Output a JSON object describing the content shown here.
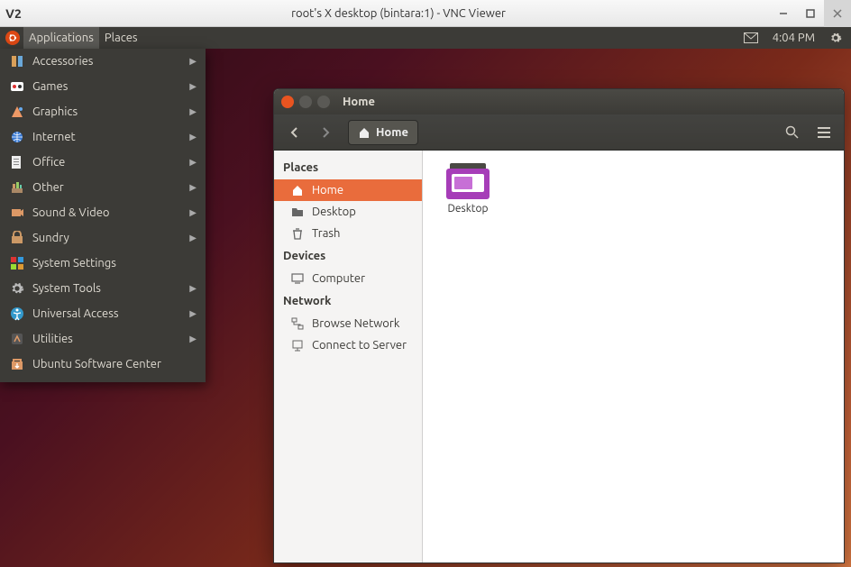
{
  "vnc": {
    "logo": "V2",
    "title": "root's X desktop (bintara:1) - VNC Viewer"
  },
  "panel": {
    "applications": "Applications",
    "places": "Places",
    "clock": "4:04 PM"
  },
  "app_menu": {
    "items": [
      {
        "label": "Accessories",
        "submenu": true
      },
      {
        "label": "Games",
        "submenu": true
      },
      {
        "label": "Graphics",
        "submenu": true
      },
      {
        "label": "Internet",
        "submenu": true
      },
      {
        "label": "Office",
        "submenu": true
      },
      {
        "label": "Other",
        "submenu": true
      },
      {
        "label": "Sound & Video",
        "submenu": true
      },
      {
        "label": "Sundry",
        "submenu": true
      },
      {
        "label": "System Settings",
        "submenu": false
      },
      {
        "label": "System Tools",
        "submenu": true
      },
      {
        "label": "Universal Access",
        "submenu": true
      },
      {
        "label": "Utilities",
        "submenu": true
      },
      {
        "label": "Ubuntu Software Center",
        "submenu": false
      }
    ]
  },
  "fm": {
    "title": "Home",
    "path_label": "Home",
    "sidebar": {
      "places_h": "Places",
      "places": [
        {
          "label": "Home",
          "icon": "home",
          "active": true
        },
        {
          "label": "Desktop",
          "icon": "folder"
        },
        {
          "label": "Trash",
          "icon": "trash"
        }
      ],
      "devices_h": "Devices",
      "devices": [
        {
          "label": "Computer",
          "icon": "computer"
        }
      ],
      "network_h": "Network",
      "network": [
        {
          "label": "Browse Network",
          "icon": "network"
        },
        {
          "label": "Connect to Server",
          "icon": "server"
        }
      ]
    },
    "files": [
      {
        "label": "Desktop"
      }
    ]
  }
}
